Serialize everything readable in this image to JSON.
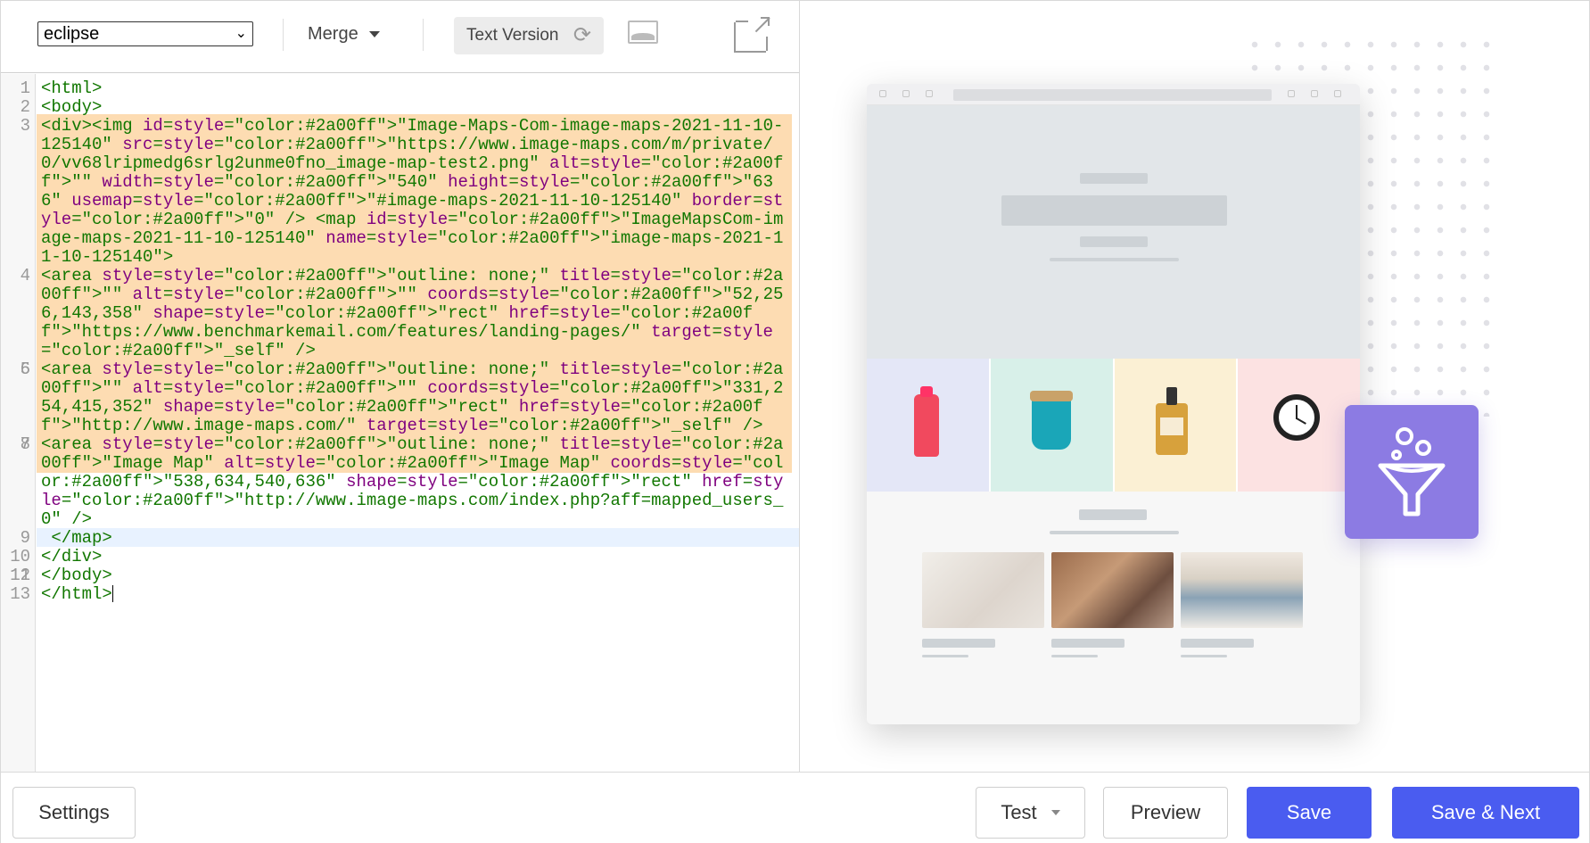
{
  "toolbar": {
    "theme_select": "eclipse",
    "merge_label": "Merge",
    "text_version_label": "Text Version"
  },
  "code": {
    "lines": [
      {
        "num": "1",
        "text": "<html>"
      },
      {
        "num": "2",
        "text": "<body>"
      },
      {
        "num": "3",
        "text": "<div><img id=\"Image-Maps-Com-image-maps-2021-11-10-125140\" src=\"https://www.image-maps.com/m/private/0/vv68lripmedg6srlg2unme0fno_image-map-test2.png\" alt=\"\" width=\"540\" height=\"636\" usemap=\"#image-maps-2021-11-10-125140\" border=\"0\" /> <map id=\"ImageMapsCom-image-maps-2021-11-10-125140\" name=\"image-maps-2021-11-10-125140\">"
      },
      {
        "num": "4",
        "text": "<area style=\"outline: none;\" title=\"\" alt=\"\" coords=\"52,256,143,358\" shape=\"rect\" href=\"https://www.benchmarkemail.com/features/landing-pages/\" target=\"_self\" />"
      },
      {
        "num": "5",
        "text": ""
      },
      {
        "num": "6",
        "text": "<area style=\"outline: none;\" title=\"\" alt=\"\" coords=\"331,254,415,352\" shape=\"rect\" href=\"http://www.image-maps.com/\" target=\"_self\" />"
      },
      {
        "num": "7",
        "text": ""
      },
      {
        "num": "8",
        "text": "<area style=\"outline: none;\" title=\"Image Map\" alt=\"Image Map\" coords=\"538,634,540,636\" shape=\"rect\" href=\"http://www.image-maps.com/index.php?aff=mapped_users_0\" />"
      },
      {
        "num": "9",
        "text": " </map>"
      },
      {
        "num": "10",
        "text": "</div>"
      },
      {
        "num": "11",
        "text": ""
      },
      {
        "num": "12",
        "text": "</body>"
      },
      {
        "num": "13",
        "text": "</html>"
      }
    ]
  },
  "footer": {
    "settings_label": "Settings",
    "test_label": "Test",
    "preview_label": "Preview",
    "save_label": "Save",
    "save_next_label": "Save & Next"
  },
  "colors": {
    "primary": "#4a5cf0",
    "highlight": "#fddcb2",
    "funnel_card": "#8c7be3"
  }
}
